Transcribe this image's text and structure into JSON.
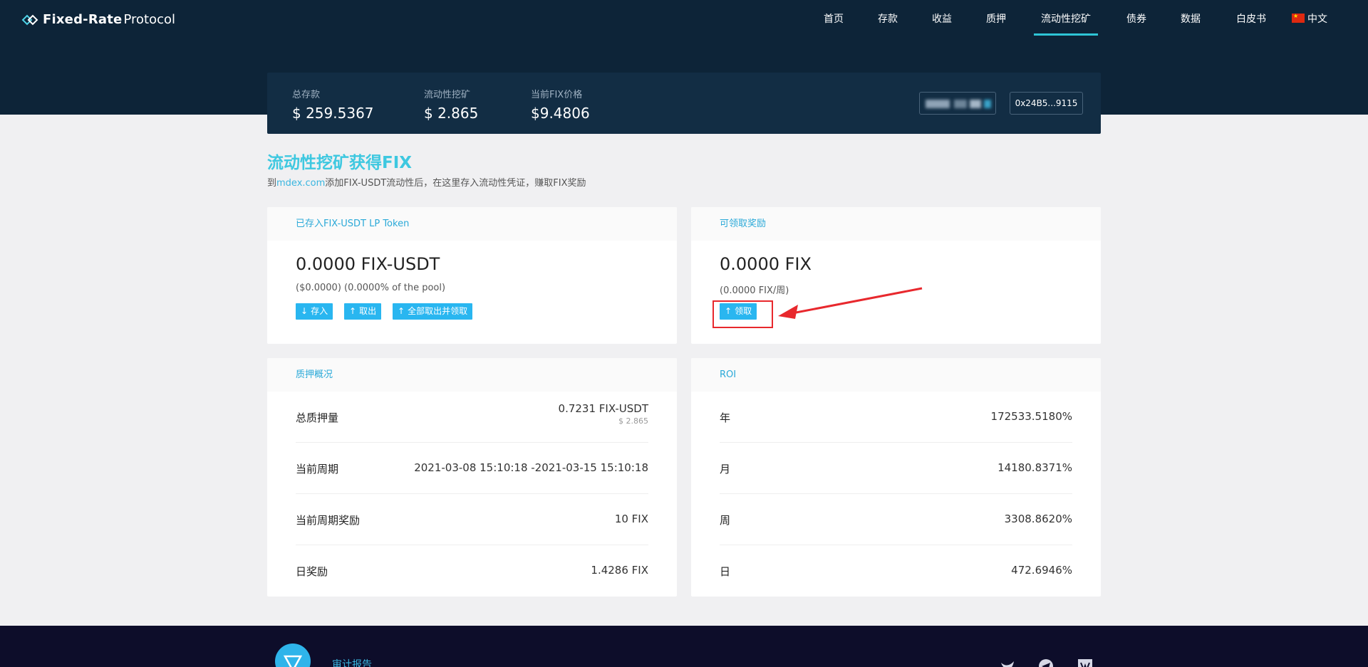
{
  "brand": {
    "name_bold": "Fixed-Rate",
    "name_light": "Protocol"
  },
  "nav": {
    "items": [
      "首页",
      "存款",
      "收益",
      "质押",
      "流动性挖矿",
      "债券",
      "数据",
      "白皮书"
    ],
    "active": "流动性挖矿",
    "lang": "中文"
  },
  "stats": [
    {
      "label": "总存款",
      "value": "$ 259.5367"
    },
    {
      "label": "流动性挖矿",
      "value": "$ 2.865"
    },
    {
      "label": "当前FIX价格",
      "value": "$9.4806"
    }
  ],
  "wallet": {
    "address": "0x24B5...9115"
  },
  "heading": {
    "title": "流动性挖矿获得FIX",
    "subtitle_pre": "到",
    "subtitle_link": "mdex.com",
    "subtitle_post": "添加FIX-USDT流动性后，在这里存入流动性凭证，赚取FIX奖励"
  },
  "deposit_card": {
    "title": "已存入FIX-USDT LP Token",
    "amount": "0.0000 FIX-USDT",
    "detail": "($0.0000) (0.0000% of the pool)",
    "buttons": [
      "存入",
      "取出",
      "全部取出并领取"
    ]
  },
  "reward_card": {
    "title": "可领取奖励",
    "amount": "0.0000 FIX",
    "detail": "(0.0000 FIX/周)",
    "button": "领取"
  },
  "pledge_card": {
    "title": "质押概况",
    "rows": [
      {
        "label": "总质押量",
        "value": "0.7231 FIX-USDT",
        "sub": "$ 2.865"
      },
      {
        "label": "当前周期",
        "value": "2021-03-08 15:10:18 -2021-03-15 15:10:18"
      },
      {
        "label": "当前周期奖励",
        "value": "10 FIX"
      },
      {
        "label": "日奖励",
        "value": "1.4286 FIX"
      }
    ]
  },
  "roi_card": {
    "title": "ROI",
    "rows": [
      {
        "label": "年",
        "value": "172533.5180%"
      },
      {
        "label": "月",
        "value": "14180.8371%"
      },
      {
        "label": "周",
        "value": "3308.8620%"
      },
      {
        "label": "日",
        "value": "472.6946%"
      }
    ]
  },
  "footer": {
    "audit_label": "审计报告"
  },
  "colors": {
    "accent": "#29b6f0",
    "header_bg": "#0d2438",
    "title": "#3ec8e0",
    "annotation": "#e8282d"
  }
}
